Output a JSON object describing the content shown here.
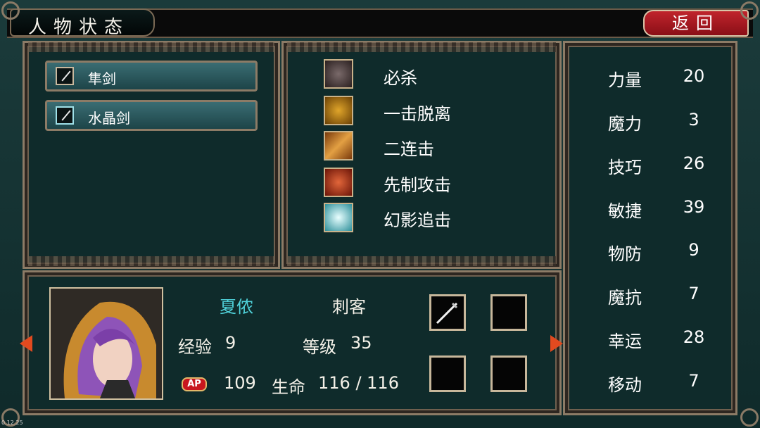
{
  "header": {
    "title": "人物状态",
    "back_label": "返回"
  },
  "weapons": [
    {
      "name": "隼剑",
      "icon": "sword-icon"
    },
    {
      "name": "水晶剑",
      "icon": "crystal-sword-icon"
    }
  ],
  "skills": [
    {
      "name": "必杀",
      "icon": "wolf-skill-icon",
      "color": "#3a2c2c"
    },
    {
      "name": "一击脱离",
      "icon": "golden-beast-skill-icon",
      "color": "#b07a15"
    },
    {
      "name": "二连击",
      "icon": "double-blade-skill-icon",
      "color": "#c7771c"
    },
    {
      "name": "先制攻击",
      "icon": "fiery-face-skill-icon",
      "color": "#c23a1e"
    },
    {
      "name": "幻影追击",
      "icon": "phantom-slash-skill-icon",
      "color": "#4ec3cf"
    }
  ],
  "stats": [
    {
      "name": "力量",
      "value": "20"
    },
    {
      "name": "魔力",
      "value": "3"
    },
    {
      "name": "技巧",
      "value": "26"
    },
    {
      "name": "敏捷",
      "value": "39"
    },
    {
      "name": "物防",
      "value": "9"
    },
    {
      "name": "魔抗",
      "value": "7"
    },
    {
      "name": "幸运",
      "value": "28"
    },
    {
      "name": "移动",
      "value": "7"
    }
  ],
  "character": {
    "name": "夏侬",
    "class": "刺客",
    "exp_label": "经验",
    "exp_value": "9",
    "level_label": "等级",
    "level_value": "35",
    "ap_badge": "AP",
    "ap_value": "109",
    "hp_label": "生命",
    "hp_value": "116 / 116"
  },
  "colors": {
    "name_accent": "#4fd0d8",
    "back_button": "#b31d26",
    "frame_border": "#8c7b66"
  },
  "footer_text": "0.12.25"
}
